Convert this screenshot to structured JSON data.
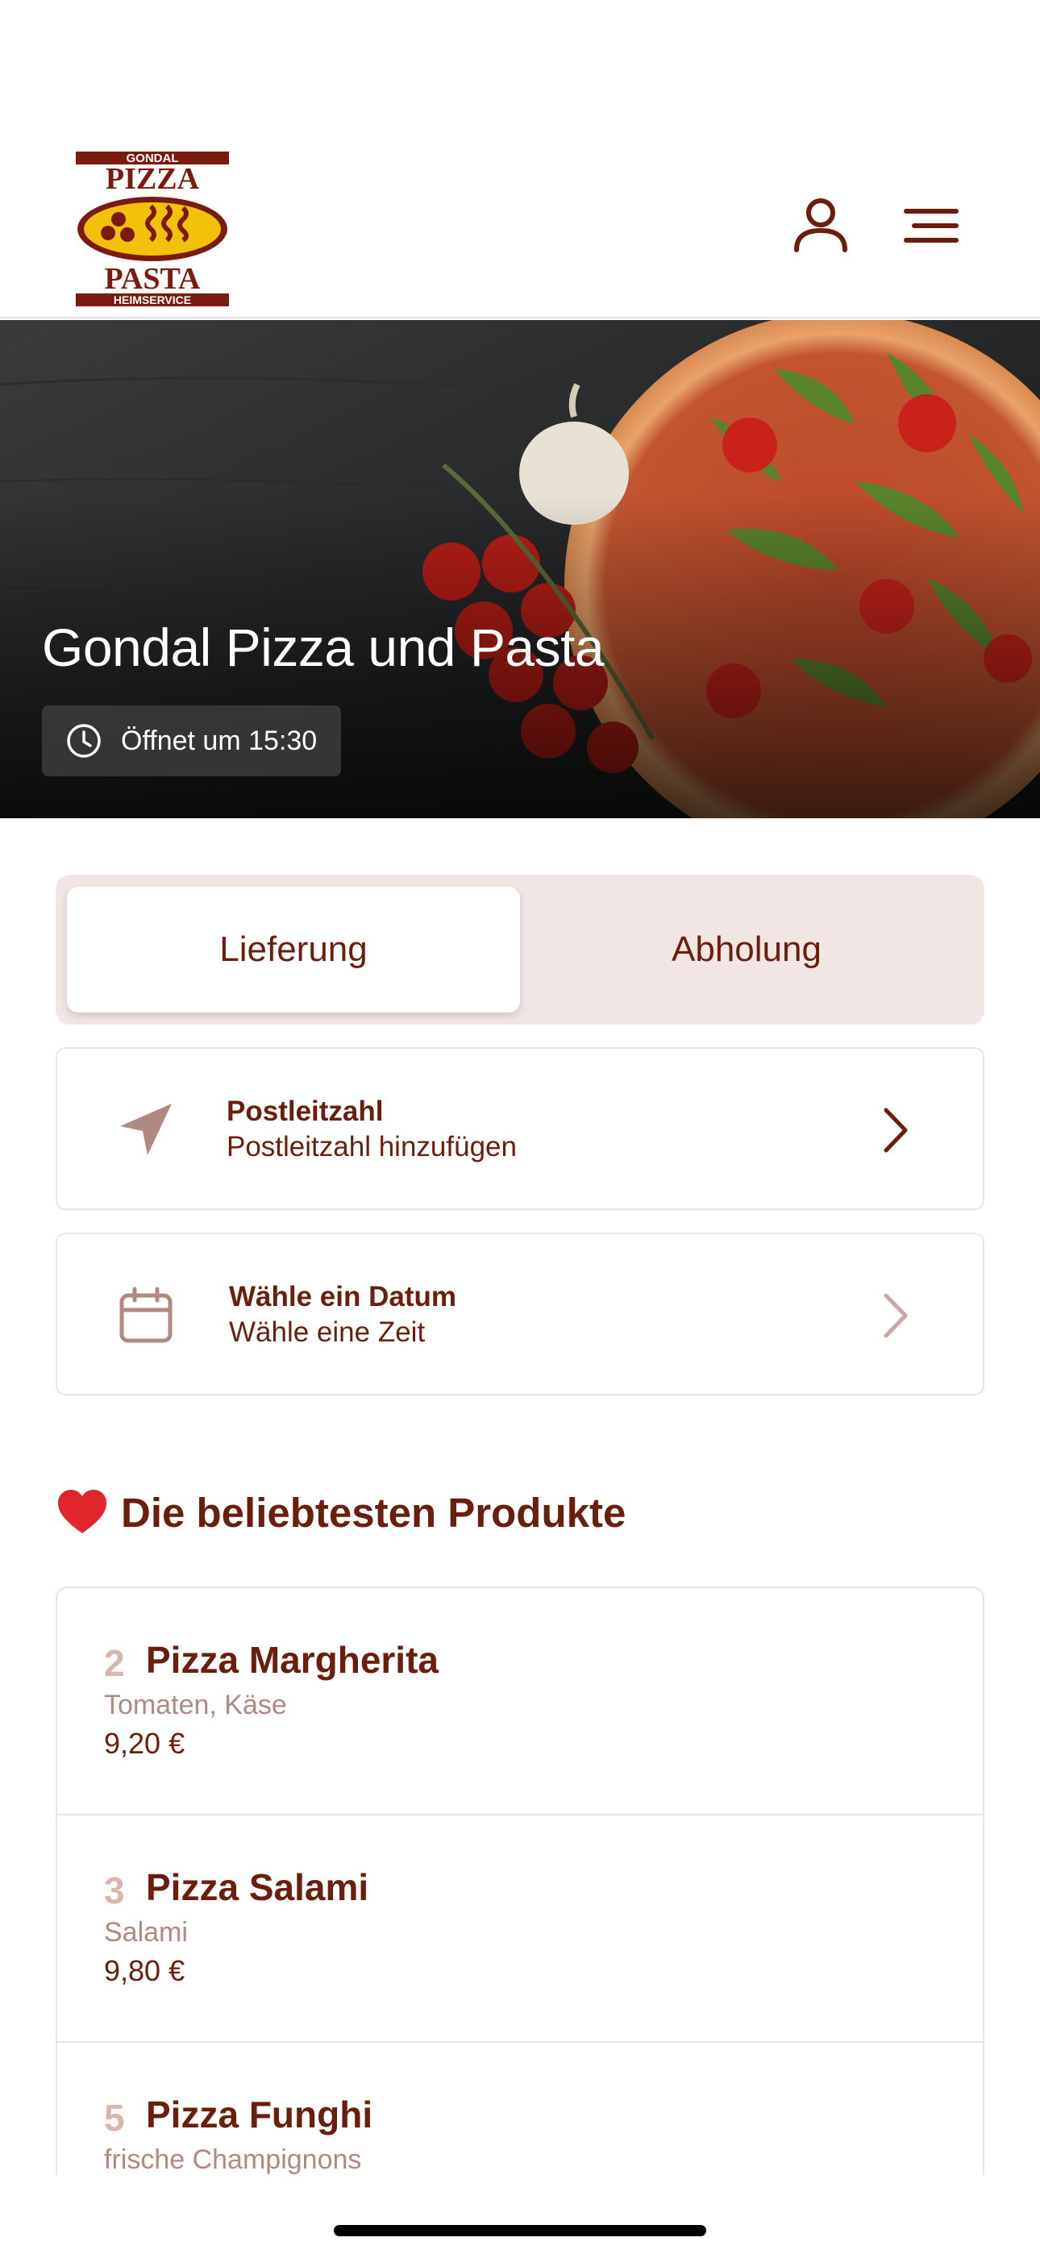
{
  "logo": {
    "top_text": "GONDAL",
    "word1": "PIZZA",
    "word2": "PASTA",
    "bottom_text": "HEIMSERVICE"
  },
  "header": {
    "icons": [
      "user-icon",
      "menu-icon"
    ]
  },
  "hero": {
    "title": "Gondal Pizza und Pasta",
    "opening_status": "Öffnet um 15:30"
  },
  "order_mode": {
    "options": [
      "Lieferung",
      "Abholung"
    ],
    "selected": "Lieferung"
  },
  "postcode_card": {
    "title": "Postleitzahl",
    "subtitle": "Postleitzahl hinzufügen"
  },
  "date_card": {
    "title": "Wähle ein Datum",
    "subtitle": "Wähle eine Zeit"
  },
  "popular": {
    "title": "Die beliebtesten Produkte",
    "products": [
      {
        "number": "2",
        "name": "Pizza Margherita",
        "description": "Tomaten, Käse",
        "price": "9,20 €"
      },
      {
        "number": "3",
        "name": "Pizza Salami",
        "description": "Salami",
        "price": "9,80 €"
      },
      {
        "number": "5",
        "name": "Pizza Funghi",
        "description": "frische Champignons",
        "price": ""
      }
    ]
  },
  "colors": {
    "brand": "#6b1d0e",
    "toggle_bg": "#f2e6e5",
    "muted": "#b08a80",
    "number": "#d7b6ae"
  }
}
